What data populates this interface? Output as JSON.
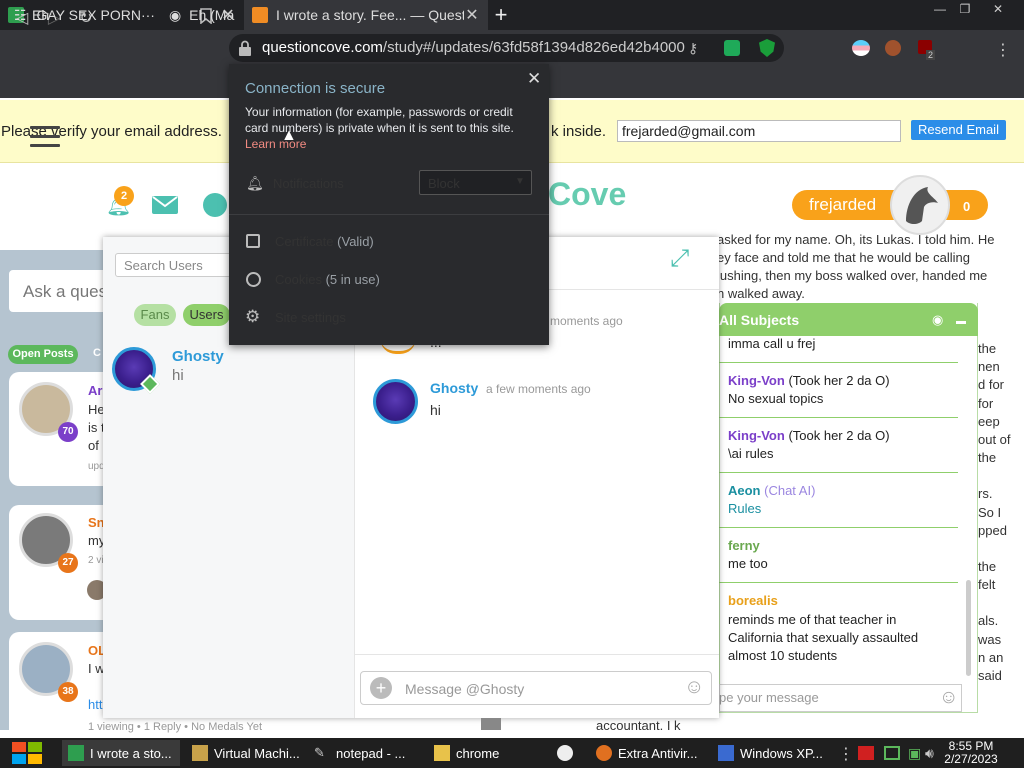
{
  "browser": {
    "tabs": [
      {
        "title": "Eh",
        "close": "✕"
      },
      {
        "title": "I wrote a story. Fee... — Questic",
        "close": "✕"
      }
    ],
    "new_tab": "+",
    "window_controls": [
      "—",
      "❐",
      "✕"
    ],
    "url_host": "questioncove.com",
    "url_path": "/study#/updates/63fd58f1394d826ed42b4000",
    "bookmarks": [
      "GAY SEX PORN···",
      "Eh (Ma"
    ]
  },
  "banner": {
    "text_left": "Please verify your email address.",
    "text_right": "k inside.",
    "email_value": "frejarded@gmail.com",
    "resend_label": "Resend Email"
  },
  "header": {
    "notification_count": "2",
    "logo_text": "Cove",
    "username": "frejarded",
    "score": "0"
  },
  "left": {
    "ask_placeholder": "Ask a ques",
    "open_posts_label": "Open Posts",
    "other_tab": "C",
    "posts": [
      {
        "name": "Ari",
        "snippet1": "He",
        "snippet2": "is t",
        "snippet3": "of l",
        "meta": "upd",
        "level": "70",
        "level_color": "#7b3fc9"
      },
      {
        "name": "Sn",
        "snippet1": "my",
        "snippet2": "2 vi",
        "level": "27",
        "level_color": "#e8751a"
      },
      {
        "name": "OL",
        "snippet1": "I w",
        "snippet2": "htt",
        "level": "38",
        "level_color": "#e8751a"
      }
    ],
    "footer": "1 viewing  •  1 Reply  •  No Medals Yet"
  },
  "chat": {
    "search_placeholder": "Search Users",
    "filter_fans": "Fans",
    "filter_users": "Users",
    "contact_name": "Ghosty",
    "contact_preview": "hi",
    "earlier_time": "moments ago",
    "earlier_text": "...",
    "message_author": "Ghosty",
    "message_time": "a few moments ago",
    "message_text": "hi",
    "input_placeholder": "Message @Ghosty"
  },
  "story_lines": [
    "asked for my name.  Oh, its Lukas.  I told him. He",
    "ey face and told me that he would be calling",
    "lushing, then my boss walked over, handed me",
    "n walked away."
  ],
  "story_right": [
    "the",
    "nen",
    "d for",
    "for",
    "eep",
    "out of",
    "the",
    "rs.",
    "So I",
    "pped",
    "the",
    "felt",
    "als.",
    "was",
    "n an",
    "said"
  ],
  "story_bottom": "accountant. I k",
  "subjects": {
    "title": "All Subjects",
    "messages": [
      {
        "name": "",
        "tag": "",
        "text": "imma call u frej",
        "color": "#333"
      },
      {
        "name": "King-Von",
        "tag": "(Took her 2 da O)",
        "text": "No sexual topics",
        "color": "#7b3fc9"
      },
      {
        "name": "King-Von",
        "tag": "(Took her 2 da O)",
        "text": "\\ai rules",
        "color": "#7b3fc9"
      },
      {
        "name": "Aeon",
        "tag": "(Chat AI)",
        "text": "Rules",
        "color": "#1a8fa0"
      },
      {
        "name": "ferny",
        "tag": "",
        "text": "me too",
        "color": "#6aa84f"
      },
      {
        "name": "borealis",
        "tag": "",
        "text": "reminds me of that teacher in California that sexually assaulted almost 10 students",
        "color": "#e8a01a"
      }
    ],
    "input_placeholder": "pe your message"
  },
  "site_info": {
    "title": "Connection is secure",
    "body1": "Your information (for example, passwords or credit",
    "body2": "card numbers) is private when it is sent to this site.",
    "learn_more": "Learn more",
    "notifications_label": "Notifications",
    "notifications_value": "Block",
    "certificate_label": "Certificate",
    "certificate_sub": "(Valid)",
    "cookies_label": "Cookies",
    "cookies_sub": "(5 in use)",
    "site_settings": "Site settings"
  },
  "taskbar": {
    "items": [
      "I wrote a sto...",
      "Virtual Machi...",
      "notepad - ...",
      "chrome",
      "Extra Antivir...",
      "Windows XP..."
    ],
    "time": "8:55 PM",
    "date": "2/27/2023"
  },
  "colors": {
    "accent_green": "#8fcf6b",
    "teal": "#4cc0b0",
    "orange": "#f9a21a",
    "blue": "#2b8de8"
  }
}
